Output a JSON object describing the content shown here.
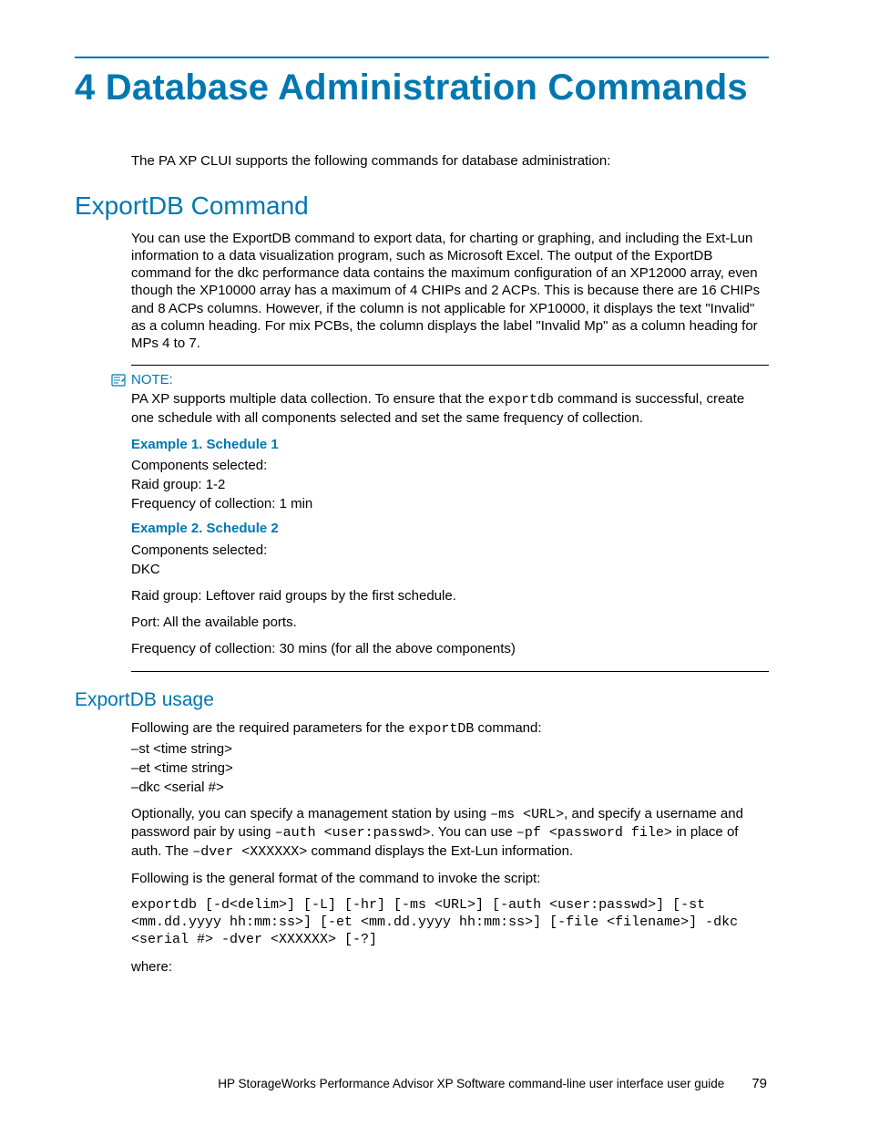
{
  "chapter": {
    "number": "4",
    "title": "Database Administration Commands"
  },
  "intro": "The PA XP CLUI supports the following commands for database administration:",
  "section1": {
    "title": "ExportDB Command",
    "para": "You can use the ExportDB command to export data, for charting or graphing, and including the Ext-Lun information to a data visualization program, such as Microsoft Excel. The output of the ExportDB command for the dkc performance data contains the maximum configuration of an XP12000 array, even though the XP10000 array has a maximum of 4 CHIPs and 2 ACPs. This is because there are 16 CHIPs and 8 ACPs columns. However, if the column is not applicable for XP10000, it displays the text \"Invalid\" as a column heading. For mix PCBs, the column displays the label \"Invalid Mp\" as a column heading for MPs 4 to 7."
  },
  "note": {
    "label": "NOTE:",
    "text_before": "PA XP supports multiple data collection. To ensure that the ",
    "code": "exportdb",
    "text_after": " command is successful, create one schedule with all components selected and set the same frequency of collection."
  },
  "example1": {
    "title": "Example 1. Schedule 1",
    "line1": "Components  selected:",
    "line2": "Raid  group:    1-2",
    "line3": "Frequency of collection: 1 min"
  },
  "example2": {
    "title": "Example 2. Schedule 2",
    "line1": "Components  selected:",
    "line2": "DKC",
    "raid": "Raid group: Leftover raid groups by the first schedule.",
    "port": "Port: All the available ports.",
    "freq": "Frequency of collection: 30 mins (for all the above components)"
  },
  "usage": {
    "title": "ExportDB usage",
    "intro_before": "Following are the required parameters for the ",
    "intro_code": "exportDB",
    "intro_after": " command:",
    "p1": "–st  <time  string>",
    "p2": "–et  <time  string>",
    "p3": "–dkc <serial #>",
    "opt_t1": "Optionally, you can specify a management station by using ",
    "opt_c1": "–ms <URL>",
    "opt_t2": ", and specify a username and password pair by using ",
    "opt_c2": "–auth <user:passwd>",
    "opt_t3": ". You can use ",
    "opt_c3": "–pf <password file>",
    "opt_t4": " in place of auth. The ",
    "opt_c4": "–dver <XXXXXX>",
    "opt_t5": " command displays the Ext-Lun information.",
    "format_intro": "Following is the general format of the command to invoke the script:",
    "format_cmd": "exportdb [-d<delim>] [-L] [-hr] [-ms <URL>] [-auth <user:passwd>] [-st <mm.dd.yyyy hh:mm:ss>] [-et <mm.dd.yyyy hh:mm:ss>] [-file <filename>] -dkc <serial #> -dver <XXXXXX> [-?]",
    "where": "where:"
  },
  "footer": {
    "text": "HP StorageWorks Performance Advisor XP Software command-line user interface user guide",
    "page": "79"
  }
}
